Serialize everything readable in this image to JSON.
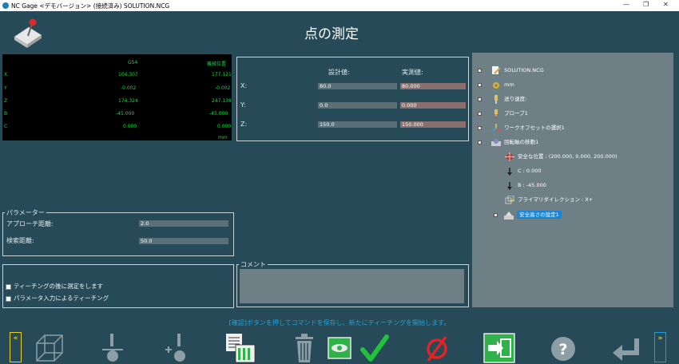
{
  "titlebar": {
    "text": "NC Gage <デモバージョン> (接続済み)  SOLUTION.NCG"
  },
  "page": {
    "title": "点の測定"
  },
  "coords": {
    "head_g54": "G54",
    "head_machine": "機械位置",
    "rows": [
      {
        "axis": "X",
        "g54": "104.307",
        "machine": "177.121"
      },
      {
        "axis": "Y",
        "g54": "-0.002",
        "machine": "-0.002"
      },
      {
        "axis": "Z",
        "g54": "174.324",
        "machine": "247.138"
      },
      {
        "axis": "B",
        "g54": "-45.000",
        "machine": "-45.000"
      },
      {
        "axis": "C",
        "g54": "0.000",
        "machine": "0.000"
      }
    ],
    "unit": "mm"
  },
  "point": {
    "design_header": "設計値:",
    "actual_header": "実測値:",
    "rows": [
      {
        "label": "X:",
        "design": "80.0",
        "actual": "80.000"
      },
      {
        "label": "Y:",
        "design": "0.0",
        "actual": "0.000"
      },
      {
        "label": "Z:",
        "design": "150.0",
        "actual": "150.000"
      }
    ]
  },
  "params": {
    "legend": "パラメーター",
    "approach_label": "アプローチ距離:",
    "approach_value": "2.0",
    "search_label": "検索距離:",
    "search_value": "50.0"
  },
  "options": {
    "measure_after_teach": "ティーチングの後に測定をします",
    "teach_by_params": "パラメータ入力によるティーチング"
  },
  "comment": {
    "legend": "コメント"
  },
  "tree": {
    "nodes": [
      {
        "label": "SOLUTION.NCG"
      },
      {
        "label": "mm"
      },
      {
        "label": "送り速度:"
      },
      {
        "label": "プローブ1"
      },
      {
        "label": "ワークオフセットの選択1"
      },
      {
        "label": "回転軸の移動1"
      },
      {
        "label": "安全な位置 : (200.000, 0.000, 200.000)"
      },
      {
        "label": "C : 0.000"
      },
      {
        "label": "B : -45.000"
      },
      {
        "label": "プライマリダイレクション : X+"
      },
      {
        "label": "安全高さの設定1"
      }
    ]
  },
  "info": {
    "message": "[確認]ボタンを押してコマンドを保存し、新たにティーチングを開始します。"
  },
  "toolbar": {
    "left_arrows": "«",
    "right_arrows": "»"
  },
  "colors": {
    "accent_green": "#2fb24a",
    "background": "#264a57",
    "tree_bg": "#6e7f86",
    "coord_text": "#13d843",
    "info_text": "#1ea3d9"
  }
}
